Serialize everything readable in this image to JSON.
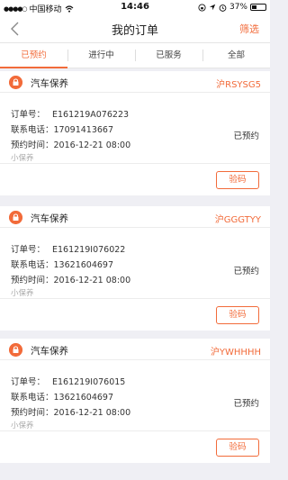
{
  "status_bar": {
    "carrier": "中国移动",
    "time": "14:46",
    "battery": "37%",
    "battery_level": 0.37
  },
  "nav": {
    "title": "我的订单",
    "filter_label": "筛选"
  },
  "tabs": [
    {
      "label": "已预约",
      "active": true
    },
    {
      "label": "进行中",
      "active": false
    },
    {
      "label": "已服务",
      "active": false
    },
    {
      "label": "全部",
      "active": false
    }
  ],
  "orders": [
    {
      "service": "汽车保养",
      "plate": "沪RSYSG5",
      "order_no_label": "订单号：",
      "order_no": "E161219A076223",
      "phone_label": "联系电话：",
      "phone": "17091413667",
      "time_label": "预约时间：",
      "time": "2016-12-21 08:00",
      "category": "小保养",
      "status": "已预约",
      "action": "验码"
    },
    {
      "service": "汽车保养",
      "plate": "沪GGGTYY",
      "order_no_label": "订单号：",
      "order_no": "E161219I076022",
      "phone_label": "联系电话：",
      "phone": "13621604697",
      "time_label": "预约时间：",
      "time": "2016-12-21 08:00",
      "category": "小保养",
      "status": "已预约",
      "action": "验码"
    },
    {
      "service": "汽车保养",
      "plate": "沪YWHHHH",
      "order_no_label": "订单号：",
      "order_no": "E161219I076015",
      "phone_label": "联系电话：",
      "phone": "13621604697",
      "time_label": "预约时间：",
      "time": "2016-12-21 08:00",
      "category": "小保养",
      "status": "已预约",
      "action": "验码"
    }
  ],
  "colors": {
    "accent": "#f26b3a",
    "background": "#efeff4"
  },
  "icons": {
    "back": "chevron-left-icon",
    "service": "lock-icon"
  }
}
